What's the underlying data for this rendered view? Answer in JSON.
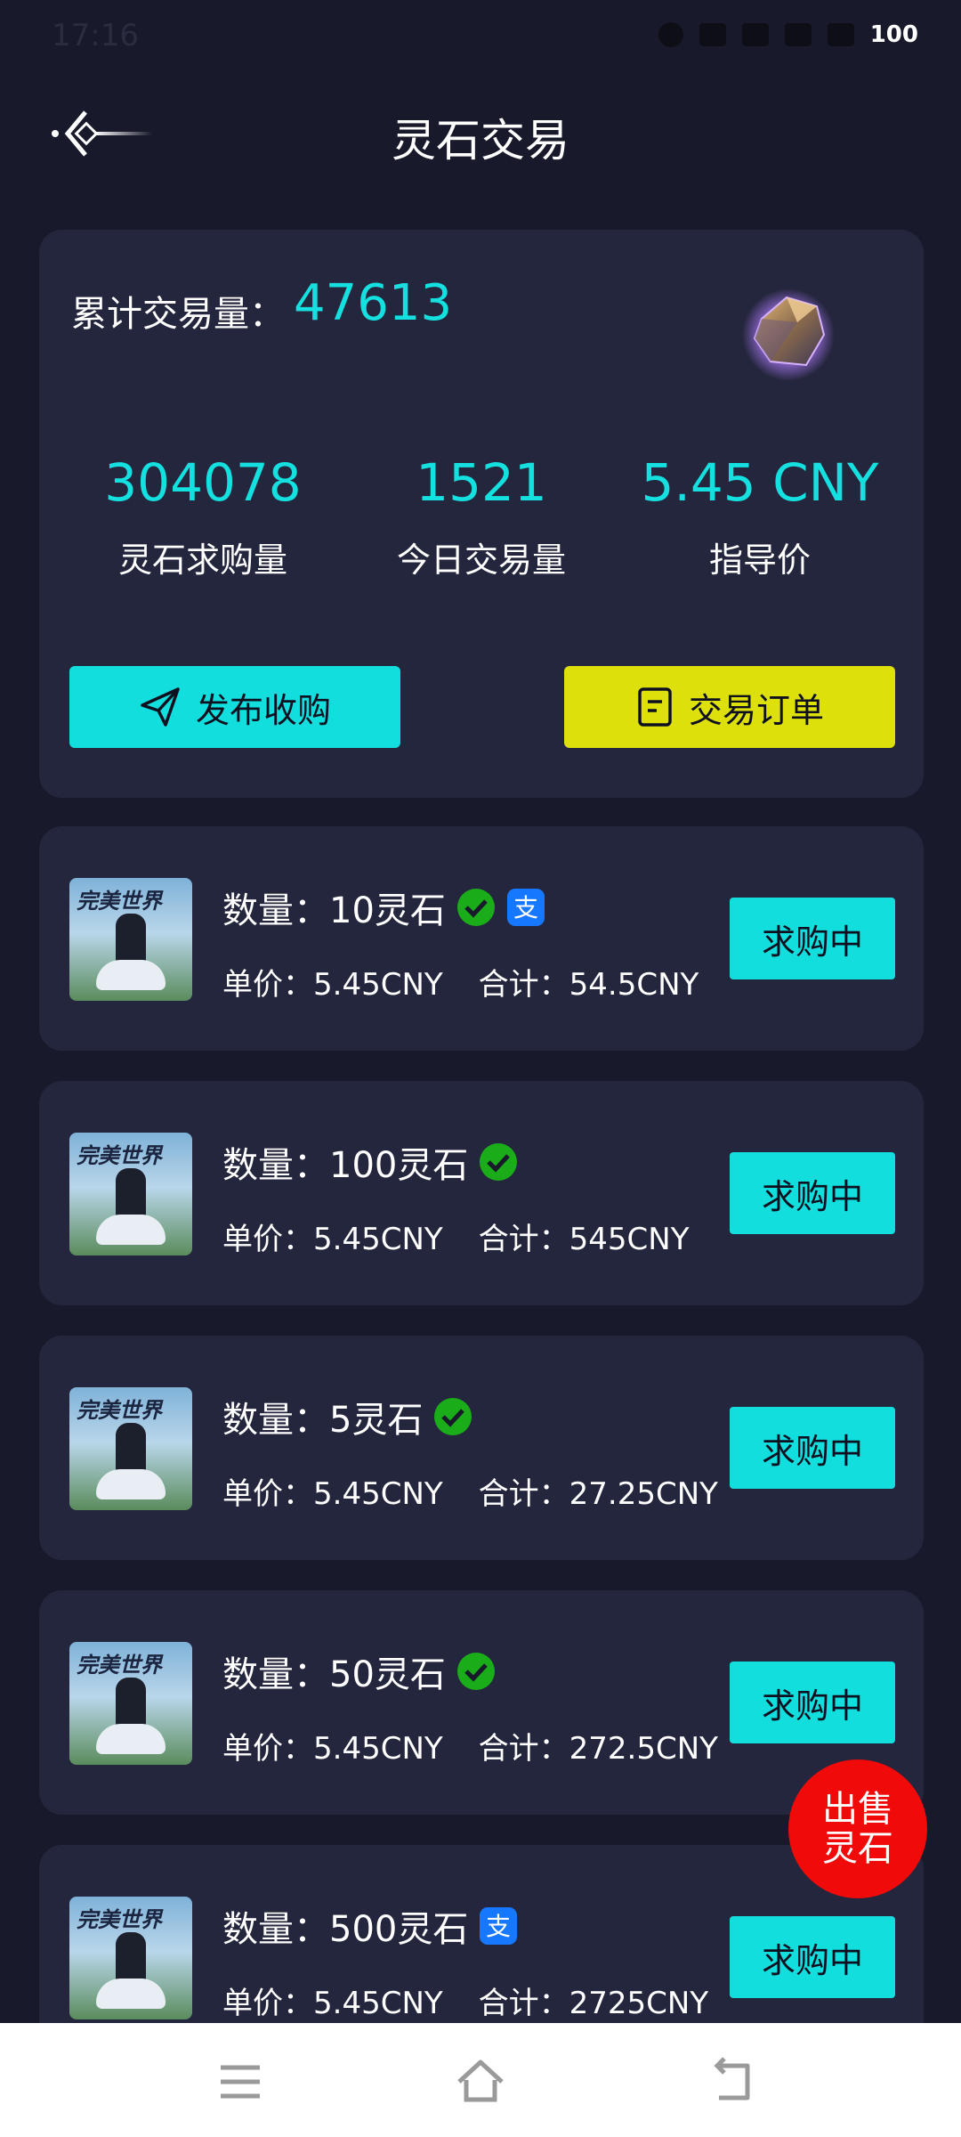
{
  "status": {
    "time": "17:16",
    "battery": "100"
  },
  "header": {
    "title": "灵石交易"
  },
  "summary": {
    "total_label": "累计交易量：",
    "total_value": "47613",
    "stats": [
      {
        "value": "304078",
        "label": "灵石求购量"
      },
      {
        "value": "1521",
        "label": "今日交易量"
      },
      {
        "value": "5.45 CNY",
        "label": "指导价"
      }
    ],
    "publish_label": "发布收购",
    "orders_label": "交易订单"
  },
  "listings": [
    {
      "thumb_text": "完美世界",
      "quantity": "数量：10灵石",
      "unit_price": "单价：5.45CNY",
      "total": "合计：54.5CNY",
      "status": "求购中",
      "payments": [
        "wechat",
        "alipay"
      ]
    },
    {
      "thumb_text": "完美世界",
      "quantity": "数量：100灵石",
      "unit_price": "单价：5.45CNY",
      "total": "合计：545CNY",
      "status": "求购中",
      "payments": [
        "wechat"
      ]
    },
    {
      "thumb_text": "完美世界",
      "quantity": "数量：5灵石",
      "unit_price": "单价：5.45CNY",
      "total": "合计：27.25CNY",
      "status": "求购中",
      "payments": [
        "wechat"
      ]
    },
    {
      "thumb_text": "完美世界",
      "quantity": "数量：50灵石",
      "unit_price": "单价：5.45CNY",
      "total": "合计：272.5CNY",
      "status": "求购中",
      "payments": [
        "wechat"
      ]
    },
    {
      "thumb_text": "完美世界",
      "quantity": "数量：500灵石",
      "unit_price": "单价：5.45CNY",
      "total": "合计：2725CNY",
      "status": "求购中",
      "payments": [
        "alipay"
      ]
    }
  ],
  "fab": {
    "line1": "出售",
    "line2": "灵石"
  },
  "colors": {
    "background": "#181a2b",
    "card": "#24263d",
    "accent_cyan": "#12dede",
    "accent_yellow": "#dee00c",
    "fab_red": "#f00a0a",
    "wechat_green": "#1aad19",
    "alipay_blue": "#1677ff"
  }
}
